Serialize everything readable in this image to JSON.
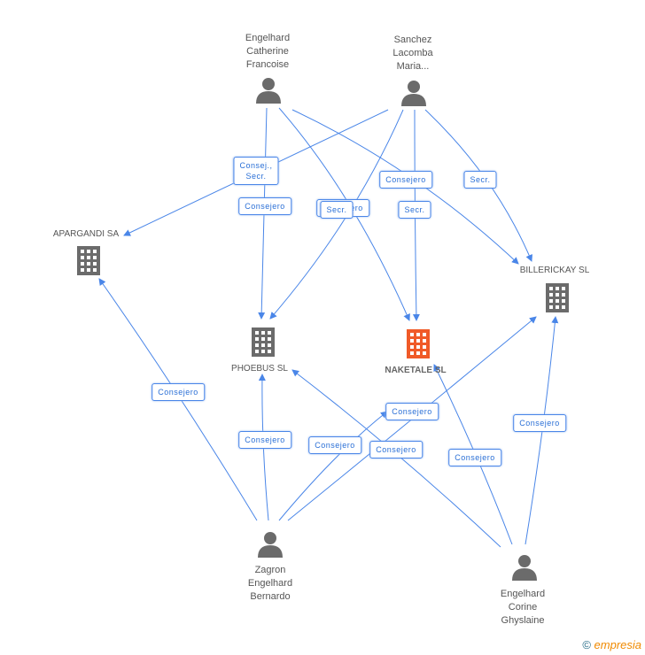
{
  "nodes": [
    {
      "id": "ecf",
      "type": "person",
      "label": "Engelhard\nCatherine\nFrancoise"
    },
    {
      "id": "slm",
      "type": "person",
      "label": "Sanchez\nLacomba\nMaria..."
    },
    {
      "id": "zeb",
      "type": "person",
      "label": "Zagron\nEngelhard\nBernardo"
    },
    {
      "id": "ecg",
      "type": "person",
      "label": "Engelhard\nCorine\nGhyslaine"
    },
    {
      "id": "apa",
      "type": "company",
      "label": "APARGANDI SA"
    },
    {
      "id": "pho",
      "type": "company",
      "label": "PHOEBUS SL"
    },
    {
      "id": "nak",
      "type": "company",
      "label": "NAKETALE SL",
      "highlight": true
    },
    {
      "id": "bil",
      "type": "company",
      "label": "BILLERICKAY SL"
    }
  ],
  "edges": [
    {
      "from": "ecf",
      "to": "pho",
      "label": "Consejero"
    },
    {
      "from": "ecf",
      "to": "nak",
      "label": "Consejero"
    },
    {
      "from": "ecf",
      "to": "bil",
      "label": "Consejero"
    },
    {
      "from": "slm",
      "to": "apa",
      "label": "Consej.,\nSecr."
    },
    {
      "from": "slm",
      "to": "pho",
      "label": "Secr."
    },
    {
      "from": "slm",
      "to": "nak",
      "label": "Secr."
    },
    {
      "from": "slm",
      "to": "bil",
      "label": "Secr."
    },
    {
      "from": "zeb",
      "to": "apa",
      "label": "Consejero"
    },
    {
      "from": "zeb",
      "to": "pho",
      "label": "Consejero"
    },
    {
      "from": "zeb",
      "to": "nak",
      "label": "Consejero"
    },
    {
      "from": "zeb",
      "to": "bil",
      "label": "Consejero"
    },
    {
      "from": "ecg",
      "to": "pho",
      "label": "Consejero"
    },
    {
      "from": "ecg",
      "to": "nak",
      "label": "Consejero"
    },
    {
      "from": "ecg",
      "to": "bil",
      "label": "Consejero"
    }
  ],
  "colors": {
    "edge": "#4a86e8",
    "company": "#6b6b6b",
    "highlight": "#f05a28",
    "person": "#6b6b6b"
  },
  "footer": {
    "copyright": "©",
    "brand": "empresia"
  }
}
